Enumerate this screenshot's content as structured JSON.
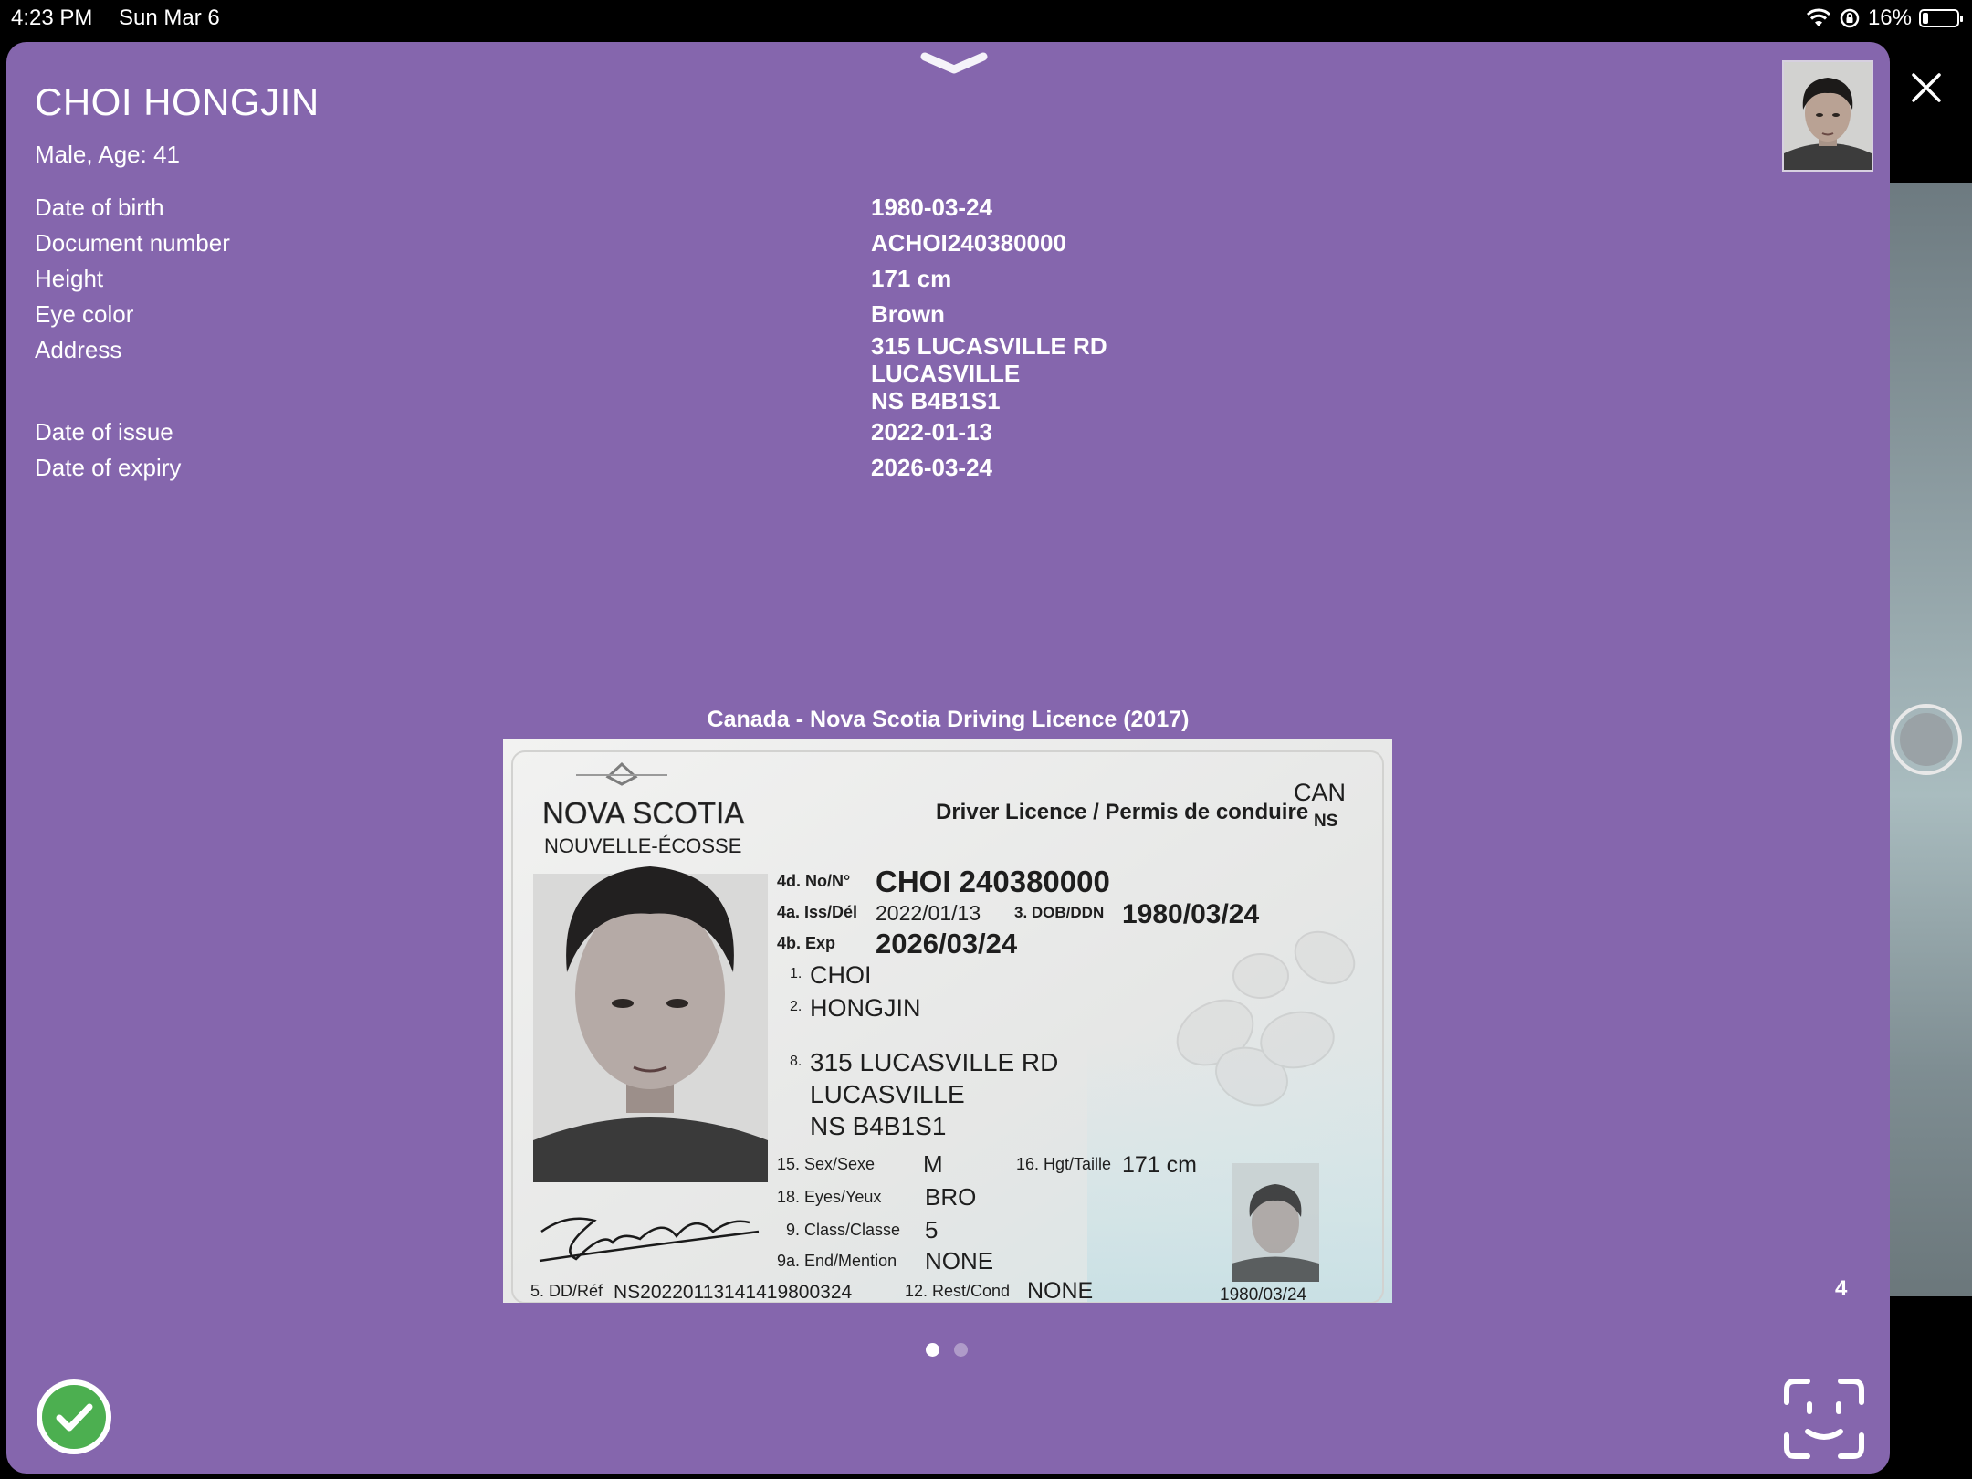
{
  "status_bar": {
    "time": "4:23 PM",
    "date": "Sun Mar 6",
    "battery": "16%",
    "battery_level": 0.16
  },
  "person": {
    "name": "CHOI HONGJIN",
    "subtitle": "Male, Age: 41"
  },
  "details": [
    {
      "label": "Date of birth",
      "value": "1980-03-24"
    },
    {
      "label": "Document number",
      "value": "ACHOI240380000"
    },
    {
      "label": "Height",
      "value": "171 cm"
    },
    {
      "label": "Eye color",
      "value": "Brown"
    },
    {
      "label": "Address",
      "value_lines": [
        "315 LUCASVILLE RD",
        "LUCASVILLE",
        "NS B4B1S1"
      ]
    },
    {
      "label": "Date of issue",
      "value": "2022-01-13"
    },
    {
      "label": "Date of expiry",
      "value": "2026-03-24"
    }
  ],
  "document": {
    "title": "Canada - Nova Scotia Driving Licence (2017)",
    "card": {
      "country": "CAN",
      "province": "NS",
      "header": "Driver Licence / Permis de conduire",
      "brand_line1": "NOVA SCOTIA",
      "brand_line2": "NOUVELLE-ÉCOSSE",
      "no_label": "4d. No/N°",
      "no_value": "CHOI 240380000",
      "iss_label": "4a. Iss/Dél",
      "iss_value": "2022/01/13",
      "dob_label": "3. DOB/DDN",
      "dob_value": "1980/03/24",
      "exp_label": "4b. Exp",
      "exp_value": "2026/03/24",
      "f1_label": "1.",
      "f1_value": "CHOI",
      "f2_label": "2.",
      "f2_value": "HONGJIN",
      "f8_label": "8.",
      "addr1": "315 LUCASVILLE RD",
      "addr2": "LUCASVILLE",
      "addr3": "NS B4B1S1",
      "sex_label": "15. Sex/Sexe",
      "sex_value": "M",
      "hgt_label": "16. Hgt/Taille",
      "hgt_value": "171 cm",
      "eyes_label": "18. Eyes/Yeux",
      "eyes_value": "BRO",
      "class_label": "9. Class/Classe",
      "class_value": "5",
      "end_label": "9a. End/Mention",
      "end_value": "NONE",
      "dd_label": "5. DD/Réf",
      "dd_value": "NS20220113141419800324",
      "rest_label": "12. Rest/Cond",
      "rest_value": "NONE",
      "ghost_date": "1980/03/24"
    }
  },
  "pager": {
    "page_count": 2,
    "active_index": 0,
    "page_number": "4"
  },
  "colors": {
    "sheet": "#8566ad",
    "accept": "#4caf50"
  },
  "icons": {
    "close": "close-icon",
    "grabber": "chevron-down-icon",
    "accept": "checkmark-icon",
    "face_scan": "face-scan-icon"
  }
}
